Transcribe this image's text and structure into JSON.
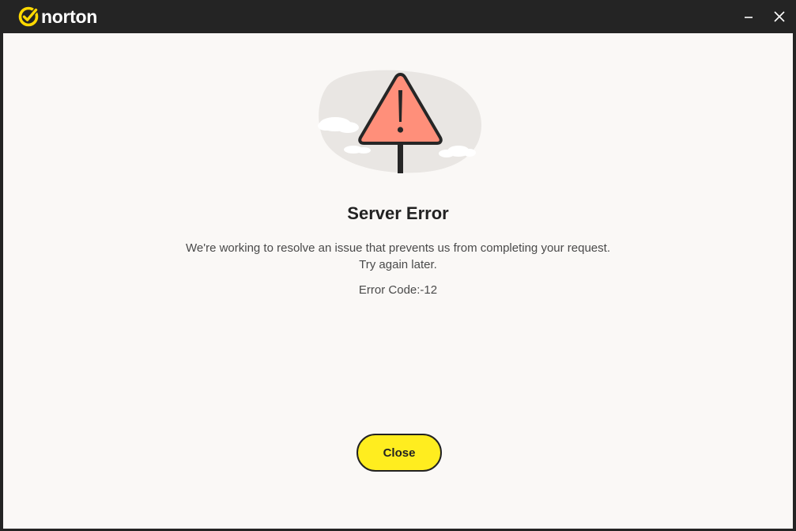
{
  "window": {
    "brand_name": "norton",
    "minimize_icon": "minimize-icon",
    "close_icon": "close-icon"
  },
  "dialog": {
    "title": "Server Error",
    "message_line1": "We're working to resolve an issue that prevents us from completing your request.",
    "message_line2": "Try again later.",
    "error_code": "Error Code:-12",
    "close_label": "Close"
  },
  "colors": {
    "titlebar_bg": "#242424",
    "content_bg": "#faf8f6",
    "brand_yellow": "#ffd900",
    "warning_fill": "#ff8f7a",
    "button_yellow": "#ffed1f",
    "text_dark": "#222222",
    "text_body": "#4a4a4a"
  }
}
